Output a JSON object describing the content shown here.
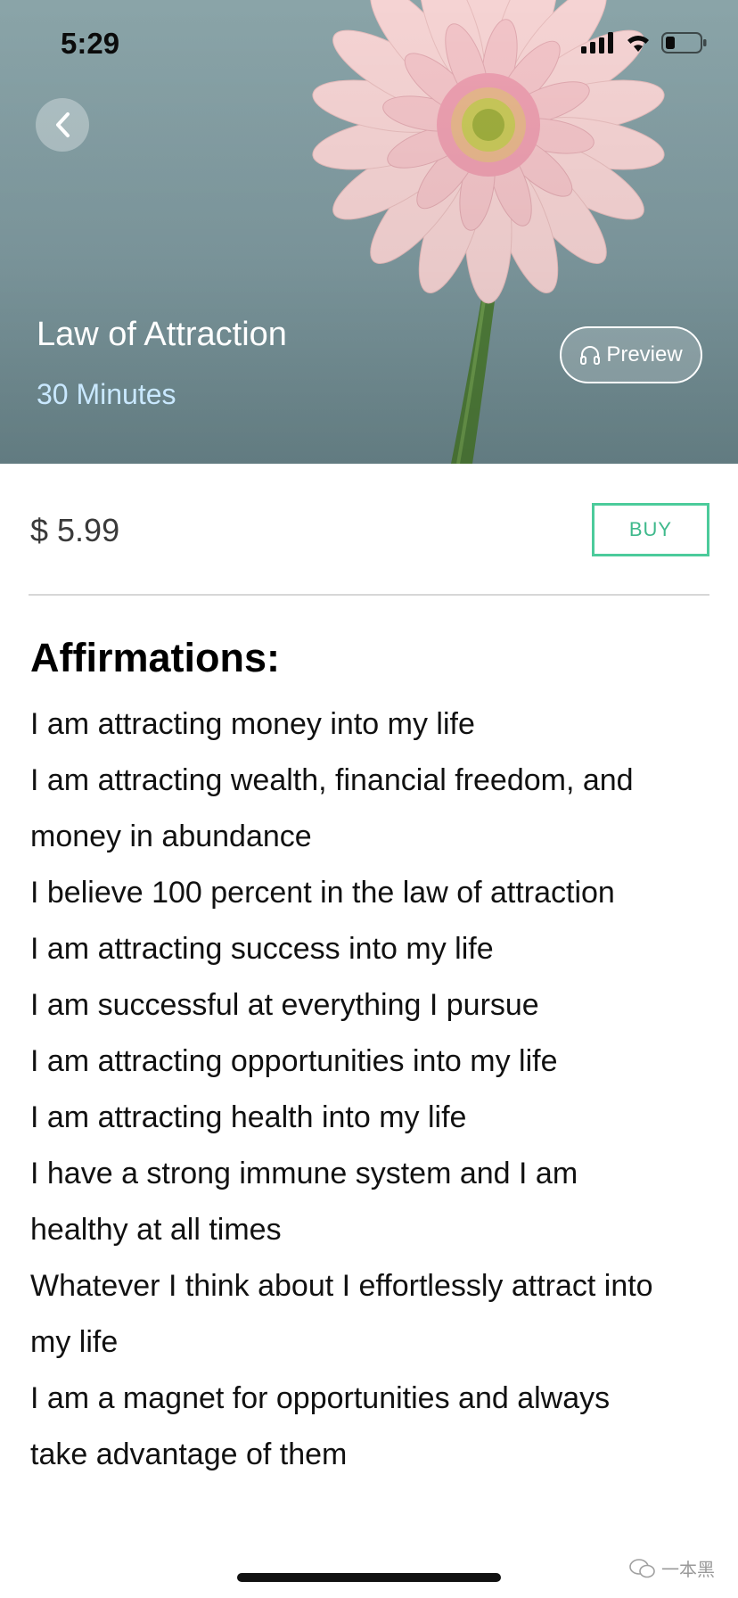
{
  "status_bar": {
    "time": "5:29",
    "icons": [
      "cellular-signal-icon",
      "wifi-icon",
      "battery-icon"
    ]
  },
  "header": {
    "back_icon": "chevron-left-icon",
    "title": "Law of Attraction",
    "duration": "30 Minutes",
    "preview_label": "Preview",
    "preview_icon": "headphones-icon"
  },
  "purchase": {
    "price": "$ 5.99",
    "buy_label": "BUY",
    "accent_color": "#4ccb9b"
  },
  "affirmations": {
    "heading": "Affirmations:",
    "lines": [
      "I am attracting money into my life",
      "I am attracting wealth, financial freedom, and",
      "money in abundance",
      "I believe 100 percent in the law of attraction",
      "I am attracting success into my life",
      "I am successful at everything I pursue",
      "I am attracting opportunities into my life",
      "I am attracting health into my life",
      "I have a strong immune system and I am",
      "healthy at all times",
      "Whatever I think about I effortlessly attract into",
      "my life",
      "I am a magnet for opportunities and always",
      "take advantage of them"
    ]
  },
  "watermark": {
    "text": "一本黑",
    "icon": "wechat-icon"
  }
}
